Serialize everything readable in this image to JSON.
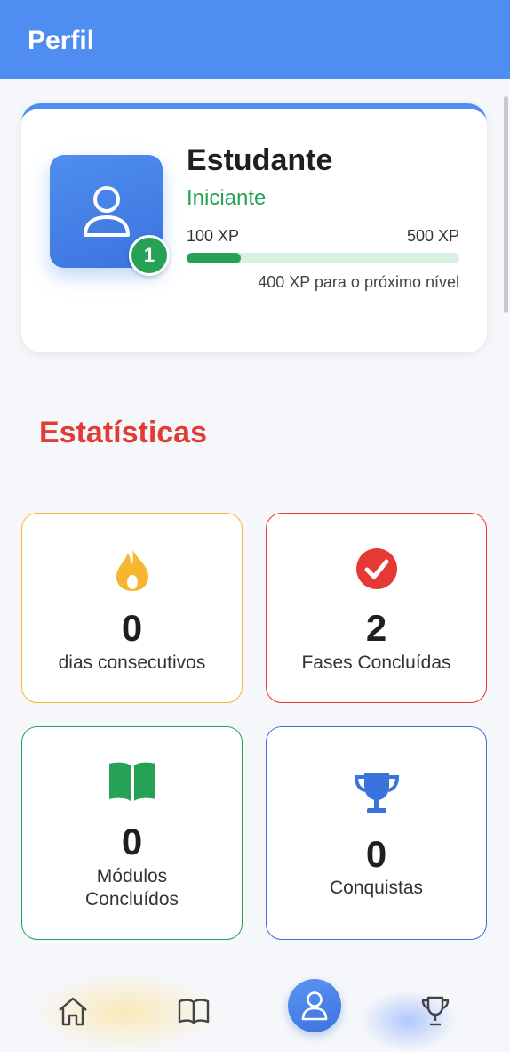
{
  "header": {
    "title": "Perfil"
  },
  "profile": {
    "name": "Estudante",
    "rank": "Iniciante",
    "level": "1",
    "xp_current_label": "100 XP",
    "xp_max_label": "500 XP",
    "xp_progress": 0.2,
    "xp_remaining_label": "400 XP para o próximo nível",
    "avatar_icon": "user-icon"
  },
  "stats": {
    "title": "Estatísticas",
    "streak": {
      "value": "0",
      "label": "dias consecutivos",
      "icon": "flame-icon",
      "color": "#f5b731"
    },
    "phases": {
      "value": "2",
      "label": "Fases Concluídas",
      "icon": "check-circle-icon",
      "color": "#e53935"
    },
    "modules": {
      "value": "0",
      "label_line1": "Módulos",
      "label_line2": "Concluídos",
      "icon": "book-icon",
      "color": "#26a257"
    },
    "achievements": {
      "value": "0",
      "label": "Conquistas",
      "icon": "trophy-icon",
      "color": "#3b73de"
    }
  },
  "nav": {
    "items": [
      {
        "name": "home",
        "icon": "home-icon"
      },
      {
        "name": "lessons",
        "icon": "book-icon"
      },
      {
        "name": "profile",
        "icon": "user-icon",
        "active": true
      },
      {
        "name": "ranking",
        "icon": "trophy-icon"
      }
    ]
  },
  "colors": {
    "primary": "#4f8ef0",
    "success": "#26a257",
    "danger": "#e53935",
    "warning": "#f5b731"
  }
}
